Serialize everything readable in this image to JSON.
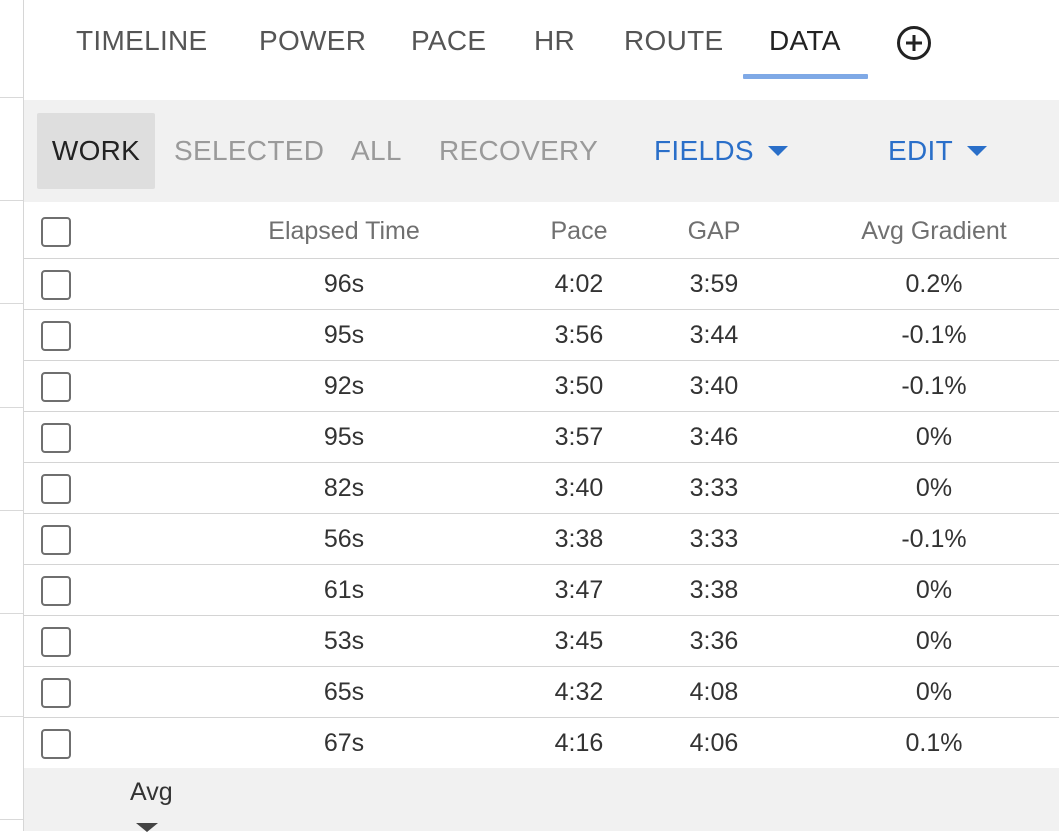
{
  "tabs": [
    {
      "label": "TIMELINE",
      "active": false
    },
    {
      "label": "POWER",
      "active": false
    },
    {
      "label": "PACE",
      "active": false
    },
    {
      "label": "HR",
      "active": false
    },
    {
      "label": "ROUTE",
      "active": false
    },
    {
      "label": "DATA",
      "active": true
    }
  ],
  "add_tab_icon": "plus-circle-icon",
  "filters": [
    {
      "label": "WORK",
      "active": true
    },
    {
      "label": "SELECTED",
      "active": false
    },
    {
      "label": "ALL",
      "active": false
    },
    {
      "label": "RECOVERY",
      "active": false
    }
  ],
  "dropdowns": {
    "fields": "FIELDS",
    "edit": "EDIT"
  },
  "table": {
    "columns": [
      "Elapsed Time",
      "Pace",
      "GAP",
      "Avg Gradient"
    ],
    "rows": [
      [
        "96s",
        "4:02",
        "3:59",
        "0.2%"
      ],
      [
        "95s",
        "3:56",
        "3:44",
        "-0.1%"
      ],
      [
        "92s",
        "3:50",
        "3:40",
        "-0.1%"
      ],
      [
        "95s",
        "3:57",
        "3:46",
        "0%"
      ],
      [
        "82s",
        "3:40",
        "3:33",
        "0%"
      ],
      [
        "56s",
        "3:38",
        "3:33",
        "-0.1%"
      ],
      [
        "61s",
        "3:47",
        "3:38",
        "0%"
      ],
      [
        "53s",
        "3:45",
        "3:36",
        "0%"
      ],
      [
        "65s",
        "4:32",
        "4:08",
        "0%"
      ],
      [
        "67s",
        "4:16",
        "4:06",
        "0.1%"
      ]
    ]
  },
  "footer": {
    "summary_label": "Avg"
  },
  "colors": {
    "accent": "#2a6fc9",
    "tab_underline": "#7fa9e6",
    "subbar_bg": "#f1f1f1",
    "active_filter_bg": "#dedede"
  }
}
